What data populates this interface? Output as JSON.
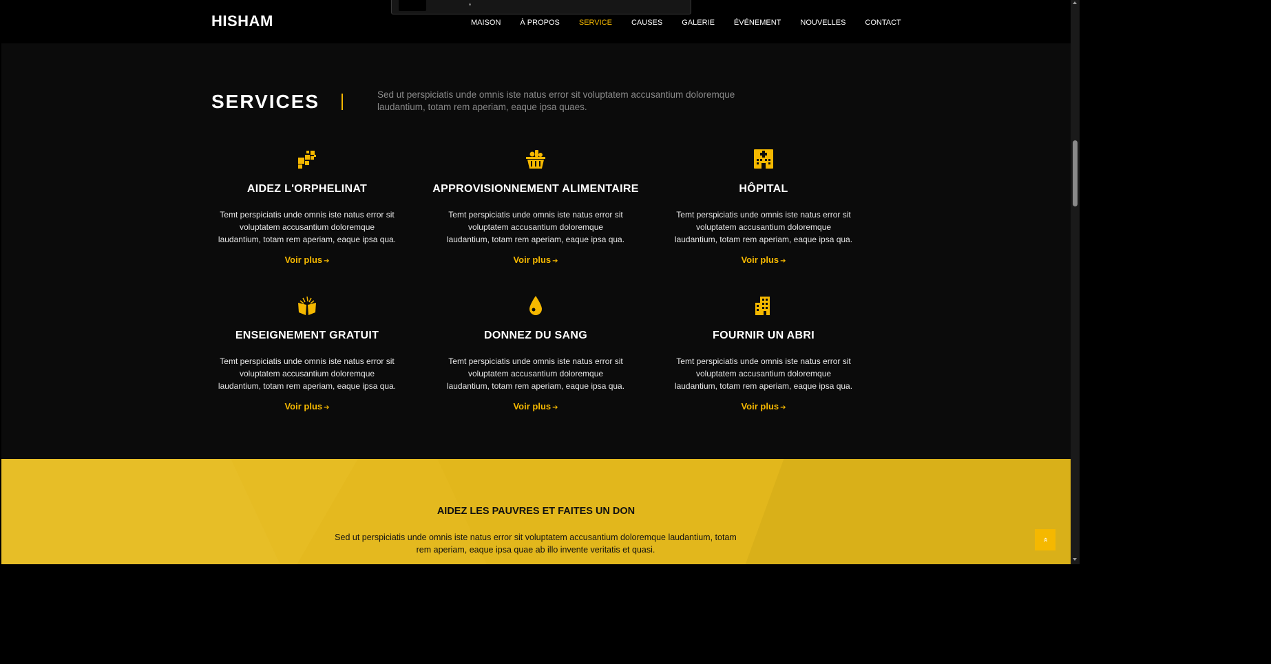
{
  "header": {
    "logo": "HISHAM",
    "nav": [
      {
        "label": "MAISON",
        "active": false
      },
      {
        "label": "À PROPOS",
        "active": false
      },
      {
        "label": "SERVICE",
        "active": true
      },
      {
        "label": "CAUSES",
        "active": false
      },
      {
        "label": "GALERIE",
        "active": false
      },
      {
        "label": "ÉVÉNEMENT",
        "active": false
      },
      {
        "label": "NOUVELLES",
        "active": false
      },
      {
        "label": "CONTACT",
        "active": false
      }
    ]
  },
  "services": {
    "title": "SERVICES",
    "description": "Sed ut perspiciatis unde omnis iste natus error sit voluptatem accusantium doloremque laudantium, totam rem aperiam, eaque ipsa quaes.",
    "cards": [
      {
        "icon": "blocks-icon",
        "title": "AIDEZ L'ORPHELINAT",
        "text": "Temt perspiciatis unde omnis iste natus error sit voluptatem accusantium doloremque laudantium, totam rem aperiam, eaque ipsa qua.",
        "link": "Voir plus"
      },
      {
        "icon": "food-basket-icon",
        "title": "APPROVISIONNEMENT ALIMENTAIRE",
        "text": "Temt perspiciatis unde omnis iste natus error sit voluptatem accusantium doloremque laudantium, totam rem aperiam, eaque ipsa qua.",
        "link": "Voir plus"
      },
      {
        "icon": "hospital-icon",
        "title": "HÔPITAL",
        "text": "Temt perspiciatis unde omnis iste natus error sit voluptatem accusantium doloremque laudantium, totam rem aperiam, eaque ipsa qua.",
        "link": "Voir plus"
      },
      {
        "icon": "open-book-icon",
        "title": "ENSEIGNEMENT GRATUIT",
        "text": "Temt perspiciatis unde omnis iste natus error sit voluptatem accusantium doloremque laudantium, totam rem aperiam, eaque ipsa qua.",
        "link": "Voir plus"
      },
      {
        "icon": "blood-drop-icon",
        "title": "DONNEZ DU SANG",
        "text": "Temt perspiciatis unde omnis iste natus error sit voluptatem accusantium doloremque laudantium, totam rem aperiam, eaque ipsa qua.",
        "link": "Voir plus"
      },
      {
        "icon": "building-icon",
        "title": "FOURNIR UN ABRI",
        "text": "Temt perspiciatis unde omnis iste natus error sit voluptatem accusantium doloremque laudantium, totam rem aperiam, eaque ipsa qua.",
        "link": "Voir plus"
      }
    ]
  },
  "cta": {
    "title": "AIDEZ LES PAUVRES ET FAITES UN DON",
    "text": "Sed ut perspiciatis unde omnis iste natus error sit voluptatem accusantium doloremque laudantium, totam rem aperiam, eaque ipsa quae ab illo invente veritatis et quasi."
  },
  "colors": {
    "accent": "#f5b800",
    "background": "#0b0b0b",
    "header": "#000000",
    "cta_background": "#e2b71c"
  }
}
